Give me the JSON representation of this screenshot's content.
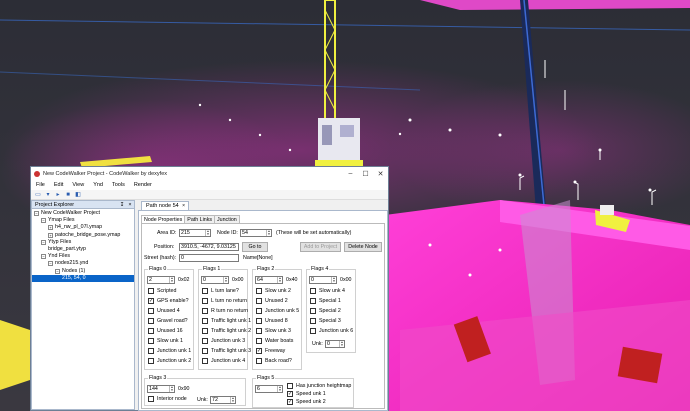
{
  "window": {
    "title": "New CodeWalker Project - CodeWalker by dexyfex",
    "controls": [
      "–",
      "☐",
      "✕"
    ]
  },
  "menu": [
    "File",
    "Edit",
    "View",
    "Ynd",
    "Tools",
    "Render"
  ],
  "explorer": {
    "title": "Project Explorer",
    "pin": "↧",
    "close": "×",
    "tree": [
      {
        "text": "New CodeWalker Project",
        "indent": 0,
        "exp": "⊟"
      },
      {
        "text": "Ymap Files",
        "indent": 1,
        "exp": "⊟"
      },
      {
        "text": "h4_nw_pl_07l.ymap",
        "indent": 2,
        "exp": "⊞"
      },
      {
        "text": "patoche_bridge_pose.ymap",
        "indent": 2,
        "exp": "⊞"
      },
      {
        "text": "Ytyp Files",
        "indent": 1,
        "exp": "⊟"
      },
      {
        "text": "bridge_part.ytyp",
        "indent": 2,
        "exp": ""
      },
      {
        "text": "Ynd Files",
        "indent": 1,
        "exp": "⊟"
      },
      {
        "text": "nodes215.ynd",
        "indent": 2,
        "exp": "⊟"
      },
      {
        "text": "Nodes (1)",
        "indent": 3,
        "exp": "⊟"
      },
      {
        "text": "215, 54, 0",
        "indent": 4,
        "exp": "",
        "selected": true
      }
    ]
  },
  "tab": {
    "label": "Path node 54",
    "close": "×"
  },
  "subtabs": [
    "Node Properties",
    "Path Links",
    "Junction"
  ],
  "form": {
    "area_id_label": "Area ID:",
    "area_id": "215",
    "node_id_label": "Node ID:",
    "node_id": "54",
    "auto_note": "(These will be set automatically)",
    "add_button": "Add to Project",
    "delete_button": "Delete Node",
    "position_label": "Position:",
    "position": "3910.5, -4672, 9.03125",
    "goto_button": "Go to",
    "street_label": "Street (hash):",
    "street": "0",
    "name_label": "Name:",
    "name": "[None]"
  },
  "groups": {
    "flags0": {
      "title": "Flags 0",
      "value": "2",
      "hex": "0x02",
      "items": [
        [
          "Scripted",
          false
        ],
        [
          "GPS enable?",
          true
        ],
        [
          "Unused 4",
          false
        ],
        [
          "Gravel road?",
          false
        ],
        [
          "Unused 16",
          false
        ],
        [
          "Slow unk 1",
          false
        ],
        [
          "Junction unk 1",
          false
        ],
        [
          "Junction unk 2",
          false
        ]
      ]
    },
    "flags1": {
      "title": "Flags 1",
      "value": "0",
      "hex": "0x00",
      "items": [
        [
          "L turn lane?",
          false
        ],
        [
          "L turn no return",
          false
        ],
        [
          "R turn no return",
          false
        ],
        [
          "Traffic light unk 1",
          false
        ],
        [
          "Traffic light unk 2",
          false
        ],
        [
          "Junction unk 3",
          false
        ],
        [
          "Traffic light unk 3",
          false
        ],
        [
          "Junction unk 4",
          false
        ]
      ]
    },
    "flags2": {
      "title": "Flags 2",
      "value": "64",
      "hex": "0x40",
      "items": [
        [
          "Slow unk 2",
          false
        ],
        [
          "Unused 2",
          false
        ],
        [
          "Junction unk 5",
          false
        ],
        [
          "Unused 8",
          false
        ],
        [
          "Slow unk 3",
          false
        ],
        [
          "Water boats",
          false
        ],
        [
          "Freeway",
          true
        ],
        [
          "Back road?",
          false
        ]
      ]
    },
    "flags4": {
      "title": "Flags 4",
      "value": "0",
      "hex": "0x00",
      "items": [
        [
          "Slow unk 4",
          false
        ],
        [
          "Special 1",
          false
        ],
        [
          "Special 2",
          false
        ],
        [
          "Special 3",
          false
        ],
        [
          "Junction unk 6",
          false
        ]
      ],
      "unk_label": "Unk:",
      "unk": "0"
    },
    "flags3": {
      "title": "Flags 3",
      "value": "144",
      "hex": "0x90",
      "interior": [
        "Interior node",
        false
      ],
      "unk_label": "Unk:",
      "unk": "72"
    },
    "flags5": {
      "title": "Flags 5",
      "value": "6",
      "items": [
        [
          "Has junction heightmap",
          false
        ],
        [
          "Speed unk 1",
          true
        ],
        [
          "Speed unk 2",
          true
        ]
      ]
    }
  }
}
